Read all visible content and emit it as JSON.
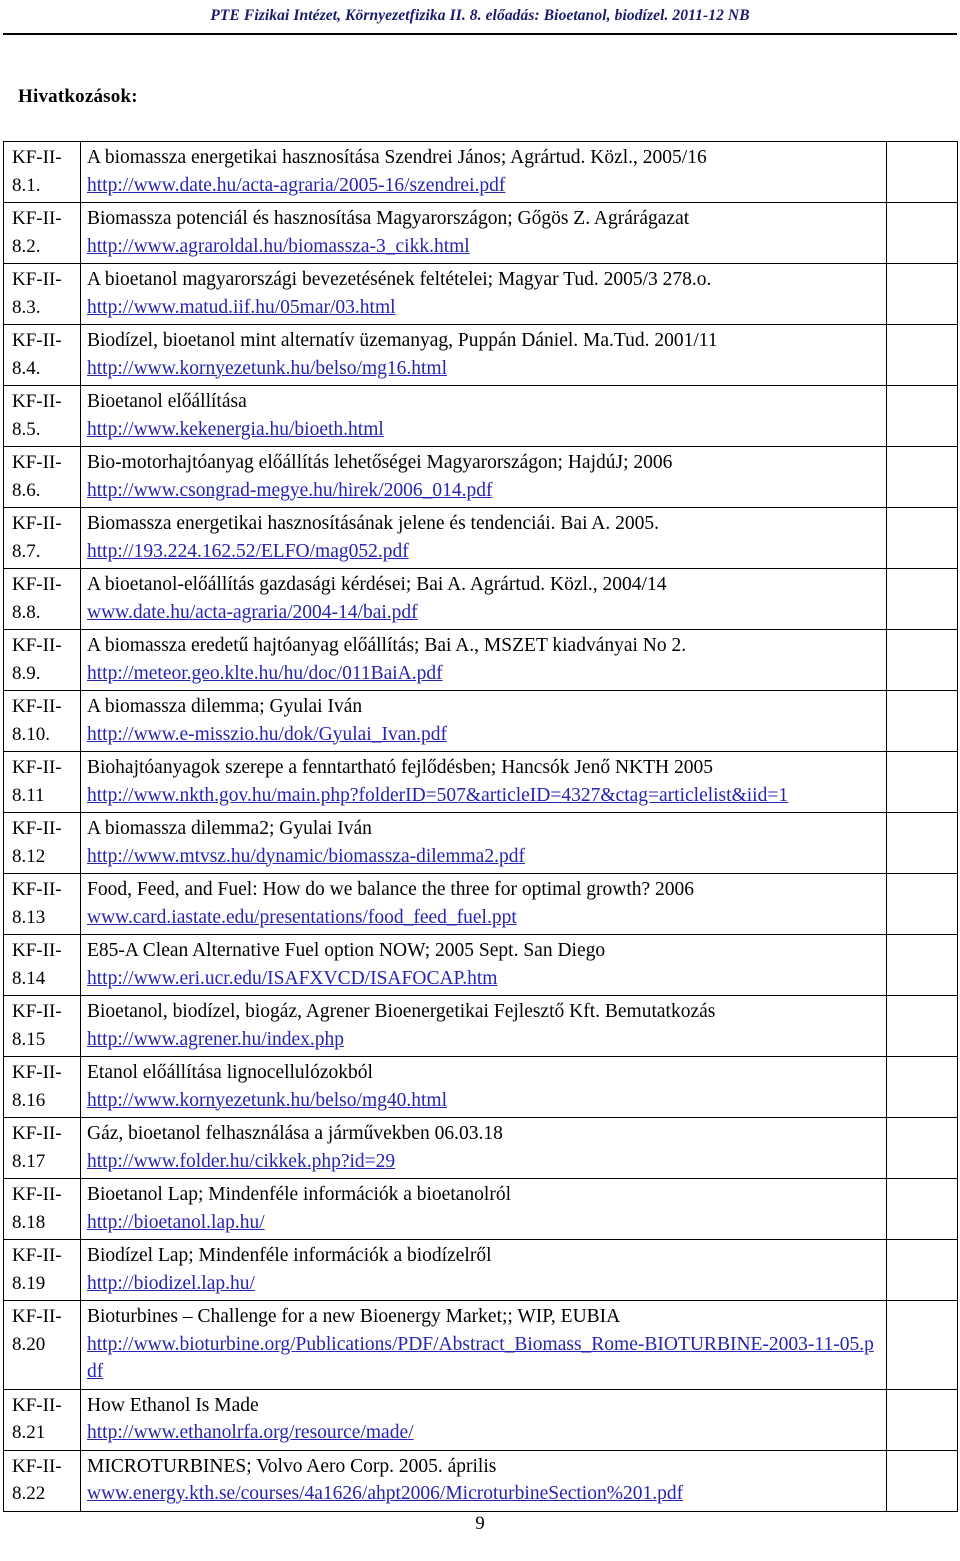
{
  "header": {
    "running_title": "PTE Fizikai Intézet, Környezetfizika II. 8. előadás: Bioetanol, biodízel. 2011-12 NB"
  },
  "section": {
    "title": "Hivatkozások:"
  },
  "colors": {
    "link": "#2525b0",
    "header_text": "#1b1b6e",
    "border": "#000000",
    "text": "#000000"
  },
  "footer": {
    "page_number": "9"
  },
  "references": [
    {
      "id_line1": "KF-II-",
      "id_line2": "8.1.",
      "title": "A biomassza energetikai hasznosítása Szendrei János; Agrártud. Közl., 2005/16",
      "link": "http://www.date.hu/acta-agraria/2005-16/szendrei.pdf",
      "lines": 2
    },
    {
      "id_line1": "KF-II-",
      "id_line2": "8.2.",
      "title": "Biomassza potenciál és hasznosítása Magyarországon; Gőgös Z. Agrárágazat",
      "link": "http://www.agraroldal.hu/biomassza-3_cikk.html",
      "lines": 2
    },
    {
      "id_line1": "KF-II-",
      "id_line2": "8.3.",
      "title": "A bioetanol magyarországi bevezetésének feltételei; Magyar Tud. 2005/3 278.o.",
      "link": "http://www.matud.iif.hu/05mar/03.html",
      "lines": 2
    },
    {
      "id_line1": "KF-II-",
      "id_line2": "8.4.",
      "title": "Biodízel, bioetanol mint alternatív üzemanyag, Puppán Dániel. Ma.Tud. 2001/11",
      "link": "http://www.kornyezetunk.hu/belso/mg16.html",
      "lines": 2
    },
    {
      "id_line1": "KF-II-",
      "id_line2": "8.5.",
      "title": "Bioetanol előállítása",
      "link": "http://www.kekenergia.hu/bioeth.html",
      "lines": 2
    },
    {
      "id_line1": "KF-II-",
      "id_line2": "8.6.",
      "title": "Bio-motorhajtóanyag előállítás lehetőségei Magyarországon; HajdúJ; 2006",
      "link": "http://www.csongrad-megye.hu/hirek/2006_014.pdf",
      "lines": 2
    },
    {
      "id_line1": "KF-II-",
      "id_line2": "8.7.",
      "title": "Biomassza energetikai hasznosításának jelene és tendenciái. Bai A. 2005.",
      "link": "http://193.224.162.52/ELFO/mag052.pdf",
      "lines": 2
    },
    {
      "id_line1": "KF-II-",
      "id_line2": "8.8.",
      "title": "A bioetanol-előállítás gazdasági kérdései; Bai A. Agrártud. Közl., 2004/14",
      "link": "www.date.hu/acta-agraria/2004-14/bai.pdf",
      "lines": 2
    },
    {
      "id_line1": "KF-II-",
      "id_line2": "8.9.",
      "title": "A biomassza eredetű hajtóanyag előállítás; Bai A., MSZET kiadványai No 2.",
      "link": "http://meteor.geo.klte.hu/hu/doc/011BaiA.pdf",
      "lines": 2
    },
    {
      "id_line1": "KF-II-",
      "id_line2": "8.10.",
      "title": "A biomassza dilemma; Gyulai Iván",
      "link": "http://www.e-misszio.hu/dok/Gyulai_Ivan.pdf",
      "lines": 2
    },
    {
      "id_line1": "KF-II-",
      "id_line2": "8.11",
      "title": "Biohajtóanyagok szerepe a fenntartható fejlődésben; Hancsók Jenő NKTH 2005",
      "link": "http://www.nkth.gov.hu/main.php?folderID=507&articleID=4327&ctag=articlelist&iid=1",
      "lines": 3
    },
    {
      "id_line1": "KF-II-",
      "id_line2": "8.12",
      "title": "A biomassza dilemma2; Gyulai Iván",
      "link": "http://www.mtvsz.hu/dynamic/biomassza-dilemma2.pdf",
      "lines": 2
    },
    {
      "id_line1": "KF-II-",
      "id_line2": "8.13",
      "title": "Food, Feed, and Fuel: How do we balance the three for optimal growth? 2006",
      "link": "www.card.iastate.edu/presentations/food_feed_fuel.ppt",
      "lines": 2
    },
    {
      "id_line1": "KF-II-",
      "id_line2": "8.14",
      "title": "E85-A Clean Alternative Fuel option NOW; 2005 Sept. San Diego",
      "link": "http://www.eri.ucr.edu/ISAFXVCD/ISAFOCAP.htm",
      "lines": 2
    },
    {
      "id_line1": "KF-II-",
      "id_line2": "8.15",
      "title": "Bioetanol, biodízel, biogáz, Agrener Bioenergetikai Fejlesztő Kft. Bemutatkozás",
      "link": "http://www.agrener.hu/index.php",
      "lines": 2
    },
    {
      "id_line1": "KF-II-",
      "id_line2": "8.16",
      "title": "Etanol előállítása lignocellulózokból",
      "link": "http://www.kornyezetunk.hu/belso/mg40.html",
      "lines": 2
    },
    {
      "id_line1": "KF-II-",
      "id_line2": "8.17",
      "title": "Gáz, bioetanol felhasználása a járművekben 06.03.18",
      "link": "http://www.folder.hu/cikkek.php?id=29",
      "lines": 2
    },
    {
      "id_line1": "KF-II-",
      "id_line2": "8.18",
      "title": "Bioetanol Lap; Mindenféle információk a bioetanolról",
      "link": "http://bioetanol.lap.hu/",
      "lines": 2
    },
    {
      "id_line1": "KF-II-",
      "id_line2": "8.19",
      "title": "Biodízel Lap; Mindenféle információk a biodízelről",
      "link": "http://biodizel.lap.hu/",
      "lines": 2
    },
    {
      "id_line1": "KF-II-",
      "id_line2": "8.20",
      "title": "Bioturbines – Challenge for a new Bioenergy Market;; WIP, EUBIA",
      "link": "http://www.bioturbine.org/Publications/PDF/Abstract_Biomass_Rome-BIOTURBINE-2003-11-05.pdf",
      "lines": 3
    },
    {
      "id_line1": "KF-II-",
      "id_line2": "8.21",
      "title": "How Ethanol Is Made",
      "link": "http://www.ethanolrfa.org/resource/made/",
      "lines": 2
    },
    {
      "id_line1": "KF-II-",
      "id_line2": "8.22",
      "title": "MICROTURBINES; Volvo Aero Corp. 2005. április",
      "link": "www.energy.kth.se/courses/4a1626/ahpt2006/MicroturbineSection%201.pdf",
      "lines": 2
    }
  ]
}
